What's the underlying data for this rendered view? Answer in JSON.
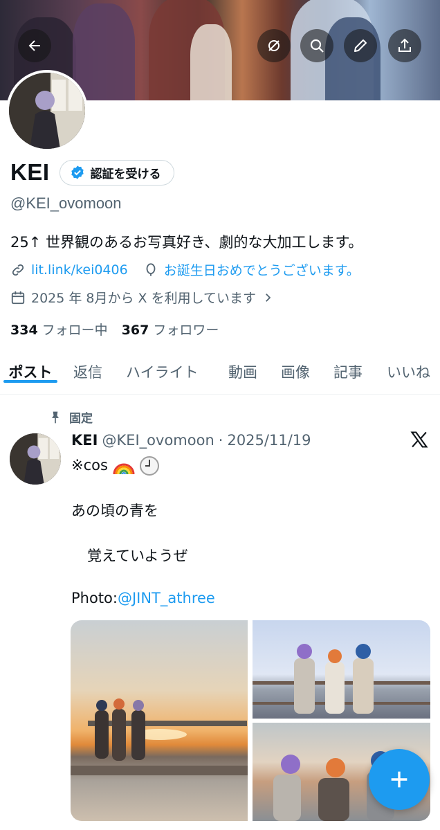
{
  "header": {
    "back_icon": "arrow-left-icon",
    "actions": [
      {
        "name": "grok-icon"
      },
      {
        "name": "search-icon"
      },
      {
        "name": "edit-icon"
      },
      {
        "name": "share-icon"
      }
    ]
  },
  "profile": {
    "display_name": "KEI",
    "verify_button_label": "認証を受ける",
    "handle": "@KEI_ovomoon",
    "bio": "25↑ 世界観のあるお写真好き、劇的な大加工します。",
    "link_text": "lit.link/kei0406",
    "birthday_text": "お誕生日おめでとうございます。",
    "joined_text": "2025 年 8月から X を利用しています",
    "following_count": "334",
    "following_label": "フォロー中",
    "followers_count": "367",
    "followers_label": "フォロワー"
  },
  "tabs": [
    {
      "label": "ポスト",
      "active": true
    },
    {
      "label": "返信",
      "active": false
    },
    {
      "label": "ハイライト",
      "active": false
    },
    {
      "label": "動画",
      "active": false
    },
    {
      "label": "画像",
      "active": false
    },
    {
      "label": "記事",
      "active": false
    },
    {
      "label": "いいね",
      "active": false
    }
  ],
  "post": {
    "pinned_label": "固定",
    "author_name": "KEI",
    "author_handle": "@KEI_ovomoon",
    "separator": "·",
    "date": "2025/11/19",
    "line1": "※cos",
    "line2": "あの頃の青を",
    "line3": "覚えていようぜ",
    "photo_prefix": "Photo:",
    "photo_credit": "@JINT_athree"
  },
  "colors": {
    "accent": "#1d9bf0",
    "text_primary": "#0f1419",
    "text_secondary": "#536471"
  }
}
